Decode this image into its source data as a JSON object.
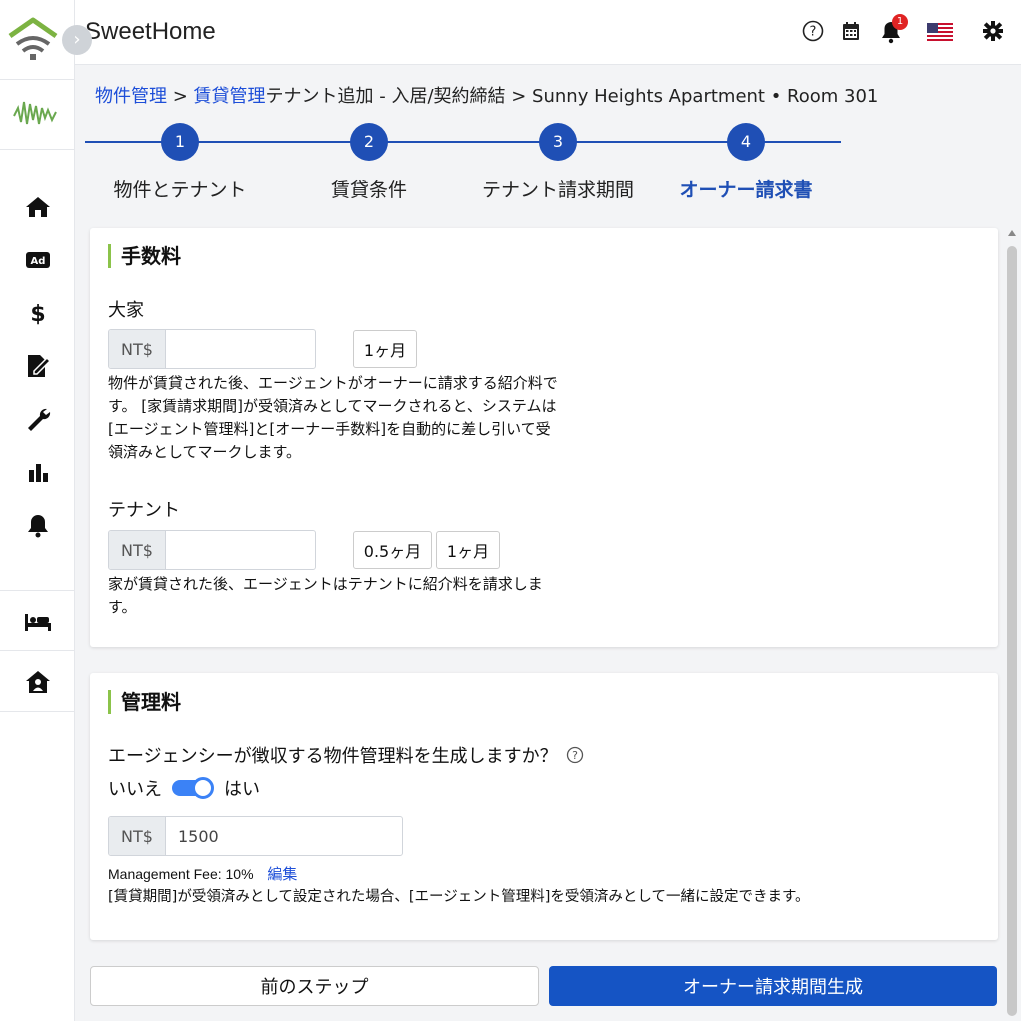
{
  "header": {
    "app_title": "SweetHome",
    "notification_count": "1",
    "icons": [
      "help-icon",
      "calendar-icon",
      "bell-icon",
      "us-flag-icon",
      "gear-icon"
    ]
  },
  "sidebar": {
    "items": [
      "home-icon",
      "ad-icon",
      "dollar-icon",
      "contract-icon",
      "wrench-icon",
      "chart-icon",
      "bell-icon"
    ],
    "lower_items": [
      "bed-icon",
      "house-user-icon"
    ]
  },
  "breadcrumb": {
    "link1": "物件管理",
    "sep1": " > ",
    "link2": "賃貸管理",
    "rest": "テナント追加 - 入居/契約締結 > Sunny Heights Apartment • Room 301"
  },
  "steps": [
    {
      "num": "1",
      "label": "物件とテナント"
    },
    {
      "num": "2",
      "label": "賃貸条件"
    },
    {
      "num": "3",
      "label": "テナント請求期間"
    },
    {
      "num": "4",
      "label": "オーナー請求書"
    }
  ],
  "commission": {
    "title": "手数料",
    "landlord": {
      "label": "大家",
      "currency": "NT$",
      "value": "",
      "chip": "1ヶ月",
      "desc": "物件が賃貸された後、エージェントがオーナーに請求する紹介料です。 [家賃請求期間]が受領済みとしてマークされると、システムは[エージェント管理料]と[オーナー手数料]を自動的に差し引いて受領済みとしてマークします。"
    },
    "tenant": {
      "label": "テナント",
      "currency": "NT$",
      "value": "",
      "chip1": "0.5ヶ月",
      "chip2": "1ヶ月",
      "desc": "家が賃貸された後、エージェントはテナントに紹介料を請求します。"
    }
  },
  "management": {
    "title": "管理料",
    "question": "エージェンシーが徴収する物件管理料を生成しますか？",
    "toggle_off": "いいえ",
    "toggle_on": "はい",
    "toggle_state": true,
    "currency": "NT$",
    "value": "1500",
    "fee_text": "Management Fee: 10%",
    "edit_label": "編集",
    "note": "[賃貸期間]が受領済みとして設定された場合、[エージェント管理料]を受領済みとして一緒に設定できます。"
  },
  "buttons": {
    "prev": "前のステップ",
    "generate": "オーナー請求期間生成"
  },
  "colors": {
    "primary": "#1554c4",
    "accent_green": "#8bc34a",
    "link": "#1d4ed8"
  }
}
